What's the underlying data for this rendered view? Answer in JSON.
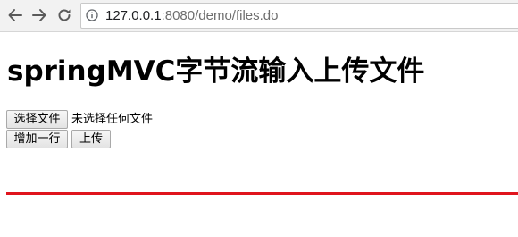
{
  "browser": {
    "url_host": "127.0.0.1",
    "url_rest": ":8080/demo/files.do",
    "back_icon": "back-arrow-icon",
    "forward_icon": "forward-arrow-icon",
    "reload_icon": "reload-icon",
    "info_icon": "info-icon"
  },
  "page": {
    "title": "springMVC字节流输入上传文件"
  },
  "form": {
    "choose_file_label": "选择文件",
    "file_status": "未选择任何文件",
    "add_row_label": "增加一行",
    "upload_label": "上传"
  },
  "colors": {
    "divider": "#e0141d"
  }
}
